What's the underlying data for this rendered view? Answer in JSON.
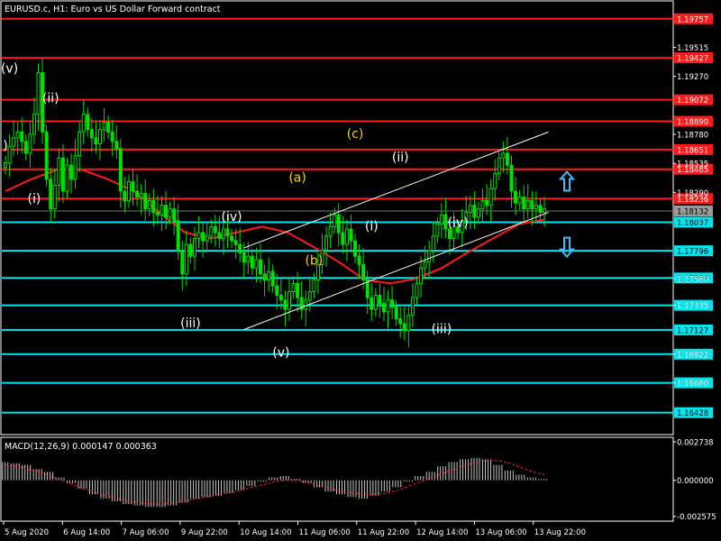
{
  "window": {
    "symbol_title": "EURUSD.c, H1:  Euro vs US Dollar Forward contract",
    "macd_title": "MACD(12,26,9) 0.000147 0.000363"
  },
  "colors": {
    "background": "#000000",
    "candles": "#00e000",
    "ma": "#ff1a1a",
    "resistance": "#ff1a1a",
    "support": "#00e5ee",
    "channel": "#ffffff",
    "count_white": "#ffffff",
    "count_yellow": "#ffd000",
    "arrows": "#39c0ff",
    "macd_hist": "#c8c8c8",
    "macd_signal": "#ff2020",
    "axis_text": "#ffffff"
  },
  "chart_data": [
    {
      "type": "line",
      "title": "EURUSD.c, H1:  Euro vs US Dollar Forward contract",
      "x_tick_labels": [
        "5 Aug 2020",
        "6 Aug 14:00",
        "7 Aug 06:00",
        "9 Aug 22:00",
        "10 Aug 14:00",
        "11 Aug 06:00",
        "11 Aug 22:00",
        "12 Aug 14:00",
        "13 Aug 06:00",
        "13 Aug 22:00"
      ],
      "y_tick_labels": [
        "1.19515",
        "1.19270",
        "1.18780",
        "1.18535",
        "1.18290",
        "1.18132",
        "1.17560",
        "1.17335",
        "1.16922",
        "1.16680"
      ],
      "ylim": [
        1.1625,
        1.199
      ],
      "grid": false,
      "current_price": "1.18132",
      "resistance_levels": [
        "1.19757",
        "1.19427",
        "1.19072",
        "1.18890",
        "1.18651",
        "1.18485",
        "1.18236"
      ],
      "support_levels": [
        "1.18037",
        "1.17796",
        "1.17566",
        "1.17335",
        "1.17127",
        "1.16922",
        "1.16680",
        "1.16428"
      ],
      "series": [
        {
          "type": "candlestick",
          "close": [
            1.1854,
            1.1868,
            1.1875,
            1.188,
            1.1872,
            1.1862,
            1.1878,
            1.1895,
            1.193,
            1.188,
            1.184,
            1.1815,
            1.1835,
            1.1858,
            1.183,
            1.1852,
            1.184,
            1.186,
            1.188,
            1.1895,
            1.1882,
            1.1875,
            1.187,
            1.1882,
            1.1888,
            1.188,
            1.1872,
            1.1866,
            1.183,
            1.1822,
            1.1838,
            1.183,
            1.1825,
            1.1828,
            1.1815,
            1.1822,
            1.1812,
            1.181,
            1.1818,
            1.1808,
            1.1815,
            1.1805,
            1.178,
            1.176,
            1.1785,
            1.1775,
            1.179,
            1.1795,
            1.1788,
            1.1792,
            1.18,
            1.1795,
            1.179,
            1.1798,
            1.1792,
            1.1788,
            1.1785,
            1.1778,
            1.177,
            1.1775,
            1.1765,
            1.1772,
            1.176,
            1.1755,
            1.1762,
            1.175,
            1.1742,
            1.1738,
            1.173,
            1.1745,
            1.1752,
            1.174,
            1.173,
            1.1738,
            1.1745,
            1.1755,
            1.1768,
            1.178,
            1.1792,
            1.18,
            1.181,
            1.1795,
            1.1785,
            1.1798,
            1.1788,
            1.1775,
            1.1768,
            1.1755,
            1.174,
            1.173,
            1.1742,
            1.1735,
            1.1728,
            1.1738,
            1.1732,
            1.1722,
            1.1718,
            1.1712,
            1.1725,
            1.174,
            1.1752,
            1.1765,
            1.177,
            1.178,
            1.1792,
            1.1802,
            1.181,
            1.1798,
            1.179,
            1.18,
            1.1795,
            1.1805,
            1.1812,
            1.1818,
            1.1808,
            1.1815,
            1.1822,
            1.1818,
            1.1832,
            1.1845,
            1.1858,
            1.1862,
            1.1852,
            1.183,
            1.182,
            1.1825,
            1.1815,
            1.1822,
            1.1815,
            1.1818,
            1.1812,
            1.1815
          ],
          "note": "hourly bars read approximately from the plot, 5 Aug 2020 to 14 Aug 2020"
        },
        {
          "name": "",
          "type": "moving-average",
          "values": [
            1.183,
            1.184,
            1.1848,
            1.1848,
            1.184,
            1.183,
            1.1812,
            1.1795,
            1.179,
            1.1795,
            1.18,
            1.1795,
            1.1783,
            1.177,
            1.1755,
            1.1752,
            1.1756,
            1.1765,
            1.1778,
            1.179,
            1.1802,
            1.1806
          ],
          "note": "red smoothing line sampled at even spacing across the candle range"
        }
      ],
      "channel_lines": {
        "upper": [
          [
            1.1782,
            1.188
          ]
        ],
        "lower": [
          [
            1.1713,
            1.1812
          ]
        ],
        "note": "parallel white trend channel drawn from 11 Aug 06:00 to 13 Aug 22:00"
      }
    },
    {
      "type": "bar",
      "title": "MACD(12,26,9) 0.000147 0.000363",
      "y_tick_labels": [
        "0.002738",
        "0.000000",
        "-0.002575"
      ],
      "ylim": [
        -0.00285,
        0.003
      ],
      "series": [
        {
          "name": "",
          "values": [
            0.0013,
            0.0012,
            0.0011,
            0.0008,
            0.0006,
            0.0002,
            -0.0002,
            -0.0006,
            -0.001,
            -0.0013,
            -0.0015,
            -0.0017,
            -0.0018,
            -0.0019,
            -0.0019,
            -0.0018,
            -0.0016,
            -0.0013,
            -0.0012,
            -0.0011,
            -0.0009,
            -0.0007,
            -0.0004,
            -0.0001,
            0.0002,
            0.0003,
            0.0001,
            -0.0002,
            -0.0005,
            -0.0008,
            -0.001,
            -0.0012,
            -0.0013,
            -0.0011,
            -0.0008,
            -0.0005,
            -0.0001,
            0.0003,
            0.0006,
            0.001,
            0.0013,
            0.0015,
            0.0016,
            0.0015,
            0.0011,
            0.0007,
            0.0004,
            0.0002,
            0.0001
          ]
        },
        {
          "name": "",
          "type": "signal-line",
          "values": [
            0.0011,
            0.001,
            0.0008,
            0.0006,
            0.0003,
            0.0,
            -0.0003,
            -0.0006,
            -0.0009,
            -0.0011,
            -0.0013,
            -0.0015,
            -0.0016,
            -0.0017,
            -0.0017,
            -0.0016,
            -0.0015,
            -0.0013,
            -0.0012,
            -0.001,
            -0.0009,
            -0.0007,
            -0.0005,
            -0.0003,
            -0.0001,
            0.0,
            0.0,
            -0.0002,
            -0.0004,
            -0.0006,
            -0.0008,
            -0.0009,
            -0.001,
            -0.001,
            -0.0009,
            -0.0007,
            -0.0004,
            -0.0001,
            0.0002,
            0.0005,
            0.0008,
            0.0011,
            0.0013,
            0.0014,
            0.0014,
            0.0012,
            0.0009,
            0.0006,
            0.0004
          ]
        }
      ]
    }
  ],
  "annotations": {
    "wave_labels": [
      {
        "text": "(v)",
        "color": "white",
        "at": [
          1,
          1.193
        ]
      },
      {
        "text": ")",
        "color": "white",
        "at": [
          0,
          1.1865
        ]
      },
      {
        "text": "(i)",
        "color": "white",
        "at": [
          7,
          1.182
        ]
      },
      {
        "text": "(ii)",
        "color": "white",
        "at": [
          11,
          1.1905
        ]
      },
      {
        "text": "(iii)",
        "color": "white",
        "at": [
          45,
          1.1715
        ]
      },
      {
        "text": "(iv)",
        "color": "white",
        "at": [
          55,
          1.1805
        ]
      },
      {
        "text": "(v)",
        "color": "white",
        "at": [
          67,
          1.169
        ]
      },
      {
        "text": "(a)",
        "color": "yellow",
        "at": [
          71,
          1.1838
        ]
      },
      {
        "text": "(b)",
        "color": "yellow",
        "at": [
          75,
          1.1768
        ]
      },
      {
        "text": "(c)",
        "color": "yellow",
        "at": [
          85,
          1.1875
        ]
      },
      {
        "text": "(i)",
        "color": "white",
        "at": [
          89,
          1.1797
        ]
      },
      {
        "text": "(ii)",
        "color": "white",
        "at": [
          96,
          1.1855
        ]
      },
      {
        "text": "(iv)",
        "color": "white",
        "at": [
          110,
          1.18
        ]
      },
      {
        "text": "(iii)",
        "color": "white",
        "at": [
          106,
          1.171
        ]
      }
    ],
    "arrows": [
      {
        "direction": "up",
        "price": 1.1838
      },
      {
        "direction": "down",
        "price": 1.1783
      }
    ]
  }
}
